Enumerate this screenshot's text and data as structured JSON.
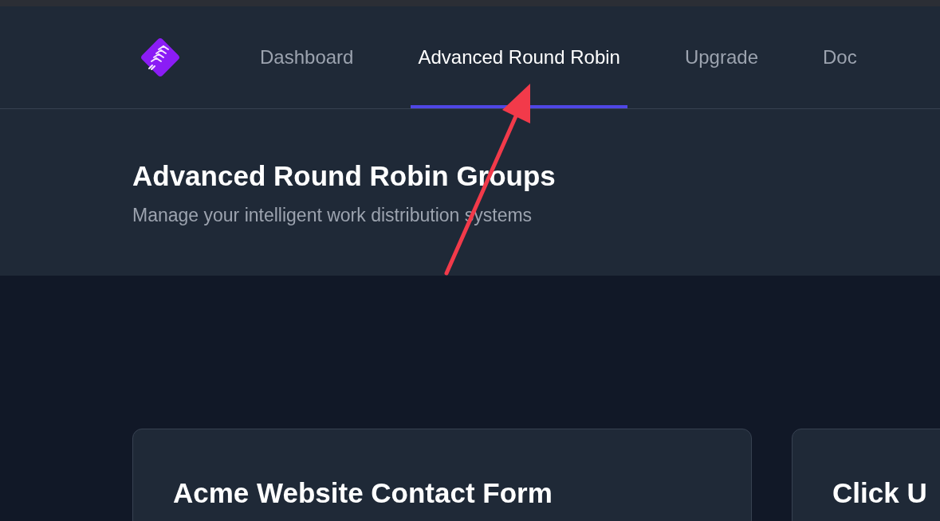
{
  "nav": {
    "tabs": [
      {
        "label": "Dashboard",
        "selected": false
      },
      {
        "label": "Advanced Round Robin",
        "selected": true
      },
      {
        "label": "Upgrade",
        "selected": false
      },
      {
        "label": "Doc",
        "selected": false
      }
    ]
  },
  "header": {
    "title": "Advanced Round Robin Groups",
    "subtitle": "Manage your intelligent work distribution systems"
  },
  "groups": [
    {
      "title": "Acme Website Contact Form"
    },
    {
      "title": "Click U"
    }
  ]
}
